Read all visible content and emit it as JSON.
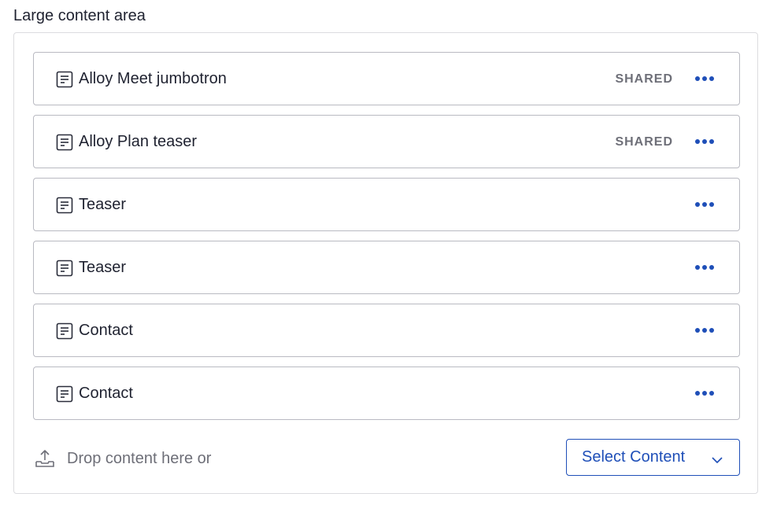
{
  "field": {
    "label": "Large content area"
  },
  "items": [
    {
      "title": "Alloy Meet jumbotron",
      "badge": "SHARED"
    },
    {
      "title": "Alloy Plan teaser",
      "badge": "SHARED"
    },
    {
      "title": "Teaser",
      "badge": ""
    },
    {
      "title": "Teaser",
      "badge": ""
    },
    {
      "title": "Contact",
      "badge": ""
    },
    {
      "title": "Contact",
      "badge": ""
    }
  ],
  "icons": {
    "item": "document-icon",
    "menu": "more-horizontal-icon",
    "upload": "upload-icon",
    "chevron": "chevron-down-icon"
  },
  "drop": {
    "text": "Drop content here or",
    "button_label": "Select Content"
  },
  "colors": {
    "accent": "#1f4fb8",
    "muted": "#6e6f78",
    "border": "#b9bac2"
  }
}
